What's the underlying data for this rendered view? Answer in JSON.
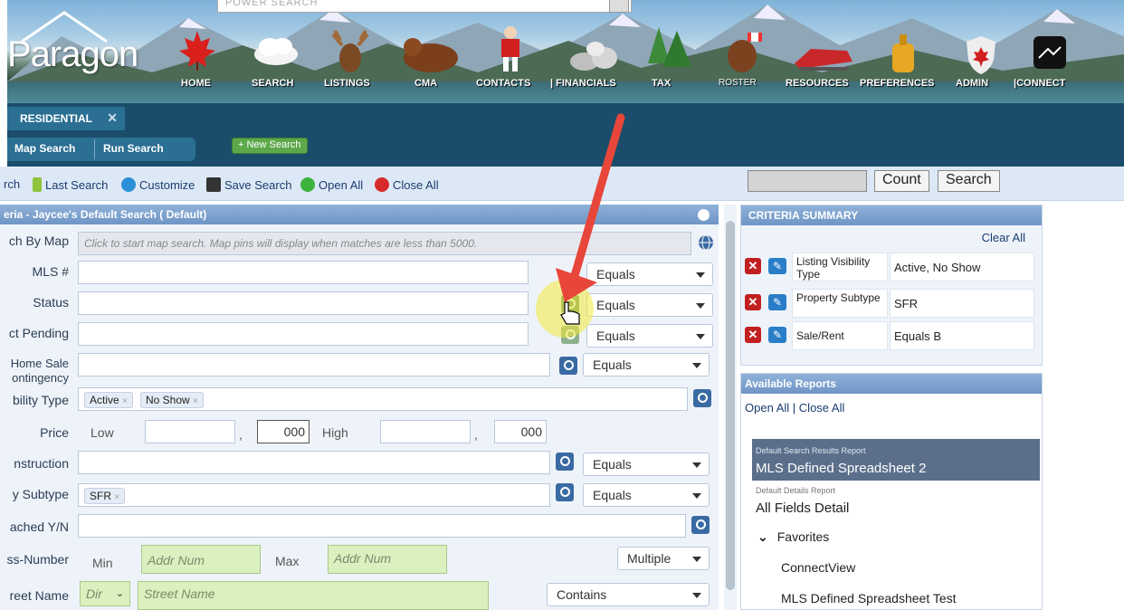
{
  "header": {
    "logo_text": "Paragon",
    "power_search_placeholder": "POWER SEARCH",
    "nav": [
      {
        "label": "HOME",
        "icon": "maple-leaf-icon"
      },
      {
        "label": "SEARCH",
        "icon": "cloud-icon"
      },
      {
        "label": "LISTINGS",
        "icon": "moose-icon"
      },
      {
        "label": "CMA",
        "icon": "bear-icon"
      },
      {
        "label": "CONTACTS",
        "icon": "hockey-player-icon"
      },
      {
        "label": "FINANCIALS",
        "icon": "rocks-icon"
      },
      {
        "label": "TAX",
        "icon": "trees-icon"
      },
      {
        "label": "ROSTER",
        "icon": "beaver-icon"
      },
      {
        "label": "RESOURCES",
        "icon": "snowmobile-icon"
      },
      {
        "label": "PREFERENCES",
        "icon": "maple-syrup-icon"
      },
      {
        "label": "ADMIN",
        "icon": "shield-icon"
      },
      {
        "label": "CONNECT",
        "icon": "connect-icon"
      }
    ]
  },
  "tabs": {
    "active": "RESIDENTIAL",
    "close": "✕"
  },
  "subtabs": {
    "map_search": "Map Search",
    "run_search": "Run Search",
    "new_search": "+ New Search"
  },
  "toolbar": {
    "search_cut": "rch",
    "last_search": "Last Search",
    "customize": "Customize",
    "save_search": "Save Search",
    "open_all": "Open All",
    "close_all": "Close All",
    "count_btn": "Count",
    "search_btn": "Search"
  },
  "criteria": {
    "header": "eria - Jaycee's Default Search ( Default)",
    "rows": {
      "map_label": "ch By Map",
      "map_placeholder": "Click to start map search. Map pins will display when matches are less than 5000.",
      "mls_label": "MLS #",
      "status_label": "Status",
      "pending_label": "ct Pending",
      "home_sale_label_1": "Home Sale",
      "home_sale_label_2": "ontingency",
      "visibility_label": "bility Type",
      "visibility_tags": [
        "Active",
        "No Show"
      ],
      "price_label": "Price",
      "price_low": "Low",
      "price_low_suffix": "000",
      "price_high": "High",
      "price_high_suffix": "000",
      "comma": ",",
      "construction_label": "nstruction",
      "subtype_label": "y Subtype",
      "subtype_tags": [
        "SFR"
      ],
      "attached_label": "ached Y/N",
      "addr_label": "ss-Number",
      "addr_min": "Min",
      "addr_max": "Max",
      "addr_placeholder": "Addr Num",
      "street_label": "reet Name",
      "street_dir": "Dir",
      "street_placeholder": "Street Name",
      "tag_x": "×"
    },
    "ops": {
      "equals": "Equals",
      "multiple": "Multiple",
      "contains": "Contains"
    }
  },
  "summary": {
    "header": "CRITERIA SUMMARY",
    "clear_all": "Clear All",
    "rows": [
      {
        "key": "Listing Visibility Type",
        "value": "Active, No Show"
      },
      {
        "key": "Property Subtype",
        "value": "SFR"
      },
      {
        "key": "Sale/Rent",
        "value": "Equals B"
      }
    ],
    "x_glyph": "✕",
    "edit_glyph": "✎"
  },
  "reports": {
    "header": "Available Reports",
    "open_all": "Open All",
    "sep": "|",
    "close_all": "Close All",
    "default_search_small": "Default Search Results Report",
    "default_search_big": "MLS Defined Spreadsheet 2",
    "default_details_small": "Default Details Report",
    "default_details_big": "All Fields Detail",
    "favorites_label": "Favorites",
    "favorites": [
      "ConnectView",
      "MLS Defined Spreadsheet Test"
    ]
  },
  "colors": {
    "nav_bg": "#1b4d6b",
    "toolbar_bg": "#dde8f6",
    "panel_header": "#7a9fcd",
    "highlight_arrow": "#e8463a",
    "cursor_halo": "#f2ea3a"
  }
}
